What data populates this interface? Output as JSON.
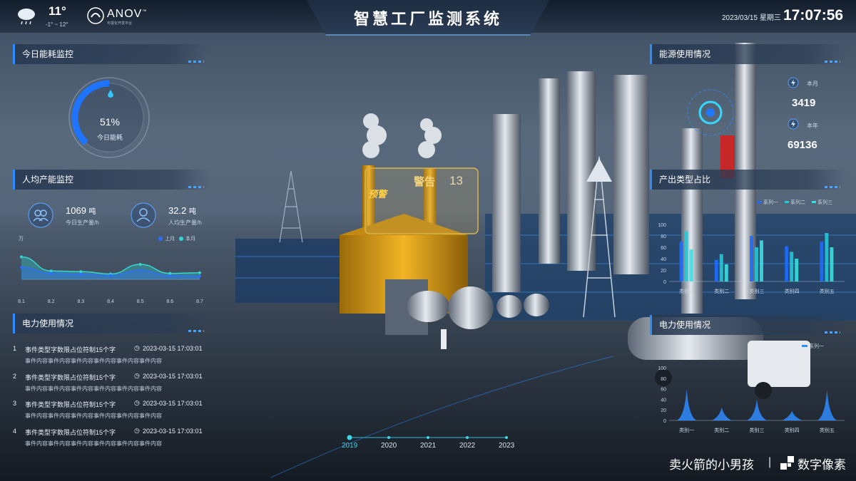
{
  "header": {
    "title": "智慧工厂监测系统",
    "temperature": "11°",
    "temp_range": "-1° ~ 12°",
    "weather_icon": "cloud-rain-icon",
    "brand": "ANOV",
    "brand_tm": "™",
    "brand_sub": "可视化开发平台",
    "date": "2023/03/15 星期三",
    "time": "17:07:56"
  },
  "left": {
    "energy": {
      "title": "今日能耗监控",
      "percent": "51%",
      "percent_value": 0.51,
      "label": "今日能耗"
    },
    "capacity": {
      "title": "人均产能监控",
      "stat1_value": "1069",
      "stat1_unit": "吨",
      "stat1_label": "今日生产量/h",
      "stat2_value": "32.2",
      "stat2_unit": "吨",
      "stat2_label": "人均生产量/h",
      "unit_label": "万",
      "legend": [
        "上月",
        "本月"
      ]
    },
    "power": {
      "title": "电力使用情况",
      "events": [
        {
          "num": "1",
          "title": "事件类型字数限占位符制15个字",
          "time": "2023-03-15 17:03:01",
          "body": "事件内容事件内容事件内容事件内容事件内容事件内容"
        },
        {
          "num": "2",
          "title": "事件类型字数限占位符制15个字",
          "time": "2023-03-15 17:03:01",
          "body": "事件内容事件内容事件内容事件内容事件内容事件内容"
        },
        {
          "num": "3",
          "title": "事件类型字数限占位符制15个字",
          "time": "2023-03-15 17:03:01",
          "body": "事件内容事件内容事件内容事件内容事件内容事件内容"
        },
        {
          "num": "4",
          "title": "事件类型字数限占位符制15个字",
          "time": "2023-03-15 17:03:01",
          "body": "事件内容事件内容事件内容事件内容事件内容事件内容"
        }
      ]
    }
  },
  "right": {
    "energy_usage": {
      "title": "能源使用情况",
      "month_label": "本月",
      "month_value": "3419",
      "year_label": "本年",
      "year_value": "69136"
    },
    "output": {
      "title": "产出类型占比"
    },
    "power": {
      "title": "电力使用情况"
    }
  },
  "timeline": {
    "years": [
      "2019",
      "2020",
      "2021",
      "2022",
      "2023"
    ],
    "active": "2019"
  },
  "billboard": {
    "label1": "警告",
    "label2": "预警",
    "number": "13"
  },
  "watermark": {
    "author": "卖火箭的小男孩",
    "divider": "|",
    "brand": "数字像素"
  },
  "colors": {
    "accent": "#2f8cff",
    "cyan": "#33d6d2",
    "gold": "#d79b17"
  },
  "chart_data": [
    {
      "type": "area",
      "ylabel": "万",
      "categories": [
        "8.1",
        "8.2",
        "8.3",
        "8.4",
        "8.5",
        "8.6",
        "8.7"
      ],
      "ylim": [
        0,
        100
      ],
      "series": [
        {
          "name": "上月",
          "color": "#2f6fff",
          "values": [
            40,
            20,
            17,
            13,
            30,
            12,
            10
          ]
        },
        {
          "name": "本月",
          "color": "#33d6d2",
          "values": [
            75,
            28,
            26,
            18,
            50,
            20,
            22
          ]
        }
      ]
    },
    {
      "type": "bar",
      "categories": [
        "类别一",
        "类别二",
        "类别三",
        "类别四",
        "类别五"
      ],
      "ylim": [
        0,
        100
      ],
      "yticks": [
        0,
        20,
        40,
        60,
        80,
        100
      ],
      "series": [
        {
          "name": "系列一",
          "color": "#1f6bff",
          "values": [
            70,
            38,
            80,
            62,
            70
          ]
        },
        {
          "name": "系列二",
          "color": "#22c8d8",
          "values": [
            88,
            48,
            60,
            52,
            85
          ]
        },
        {
          "name": "系列三",
          "color": "#37e0e0",
          "values": [
            56,
            30,
            72,
            40,
            60
          ]
        }
      ]
    },
    {
      "type": "area",
      "categories": [
        "类别一",
        "类别二",
        "类别三",
        "类别四",
        "类别五"
      ],
      "ylim": [
        0,
        100
      ],
      "yticks": [
        0,
        20,
        40,
        60,
        80,
        100
      ],
      "series": [
        {
          "name": "系列一",
          "color": "#2f8cff",
          "values": [
            60,
            25,
            40,
            18,
            58
          ]
        }
      ]
    }
  ]
}
